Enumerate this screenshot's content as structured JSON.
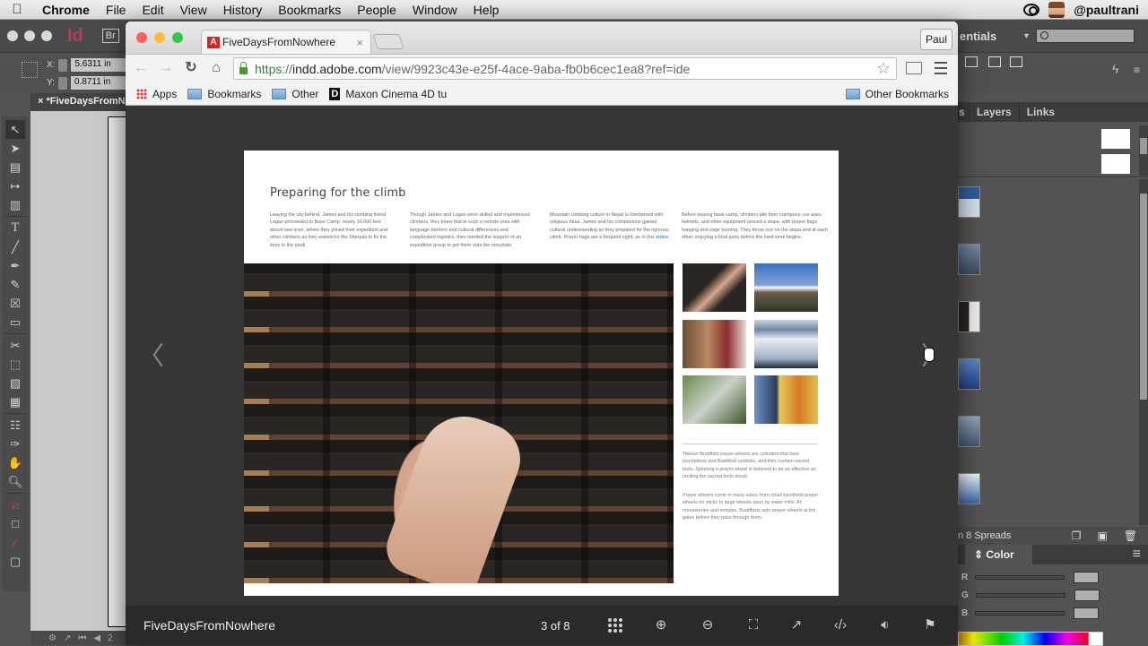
{
  "menubar": {
    "apple": "",
    "items": [
      "Chrome",
      "File",
      "Edit",
      "View",
      "History",
      "Bookmarks",
      "People",
      "Window",
      "Help"
    ],
    "user": "@paultrani",
    "icons": [
      "creative-cloud-icon",
      "user-avatar"
    ]
  },
  "indesign": {
    "logo": "Id",
    "bridge": "Br",
    "x_label": "X:",
    "x_value": "5.6311 in",
    "y_label": "Y:",
    "y_value": "0.8711 in",
    "doc_tab": "*FiveDaysFromNowhere",
    "doc_tab_close": "×",
    "workspace": "entials",
    "workspace_arrow": "▾",
    "panel_tabs": [
      "s",
      "Layers",
      "Links"
    ],
    "pages_status": "n 8 Spreads",
    "color_panel_title": "Color",
    "color_channels": [
      "R",
      "G",
      "B"
    ],
    "page_number": "2",
    "tools": [
      "selection",
      "direct-selection",
      "page",
      "gap",
      "content-collector",
      "type",
      "line",
      "pen",
      "pencil",
      "rectangle-frame",
      "rectangle",
      "scissors",
      "free-transform",
      "gradient-swatch",
      "gradient-feather",
      "note",
      "eyedropper",
      "hand",
      "zoom",
      "fill-stroke",
      "formatting",
      "apply-none",
      "screen-mode"
    ]
  },
  "chrome": {
    "tab_title": "FiveDaysFromNowhere",
    "tab_close": "×",
    "profile": "Paul",
    "url_scheme": "https",
    "url_sep": "://",
    "url_host": "indd.adobe.com",
    "url_path": "/view/9923c43e-e25f-4ace-9aba-fb0b6cec1ea8?ref=ide",
    "bookmarks": [
      {
        "label": "Apps",
        "icon": "apps-icon"
      },
      {
        "label": "Bookmarks",
        "icon": "folder-icon"
      },
      {
        "label": "Other",
        "icon": "folder-icon"
      },
      {
        "label": "Maxon Cinema 4D tu",
        "icon": "d-icon"
      }
    ],
    "other_bookmarks": "Other Bookmarks"
  },
  "viewer": {
    "page": {
      "title": "Preparing for the  climb",
      "columns": [
        "Leaving the city behind, James and his climbing friend Logan proceeded to Base Camp, nearly 16,000 feet above sea level, where they joined their expedition and other climbers as they waited for the Sherpas to fix the lines to the peak.",
        "Though James and Logan were skilled and experienced climbers, they knew that in such a remote area with language barriers and cultural differences and complicated logistics, they needed the support of an expedition group to get them onto the mountain.",
        "Mountain climbing culture in Nepal is intertwined with religious ritual. James and his companions gained cultural understanding as they prepared for the rigorous climb. Prayer flags are a frequent sight, as in this ",
        "Before leaving base camp, climbers pile their crampons, ice axes, helmets, and other equipment around a stupa, with prayer flags hanging and sage burning. They throw rice on the stupa and at each other, enjoying a final party before the hard work begins."
      ],
      "video_link": "video",
      "col3_end": ".",
      "captions": [
        "Tibetan Buddhist prayer wheels are cylinders that bear inscriptions and Buddhist symbols, and they contain sacred texts. Spinning a prayer wheel is believed to be as effective as reciting the sacred texts aloud.",
        "Prayer wheels come in many sizes, from small handheld prayer wheels on sticks to large wheels spun by water mills. At monasteries and temples, Buddhists spin prayer wheels at the gates before they pass through them."
      ],
      "thumbnails": [
        "prayer-wheel-hand",
        "stupa-mountain",
        "people-talking",
        "prayer-flags-peak",
        "river-forest",
        "climber-tent"
      ]
    },
    "doc_name": "FiveDaysFromNowhere",
    "page_count": "3 of 8",
    "toolbar_icons": [
      "grid-icon",
      "zoom-in-icon",
      "zoom-out-icon",
      "fullscreen-icon",
      "share-icon",
      "embed-icon",
      "volume-icon",
      "flag-icon"
    ]
  },
  "colors": {
    "link": "#2aa0d8",
    "url_green": "#2a8a2a",
    "viewer_bg": "#363636",
    "viewer_bar": "#2a2a2a"
  }
}
